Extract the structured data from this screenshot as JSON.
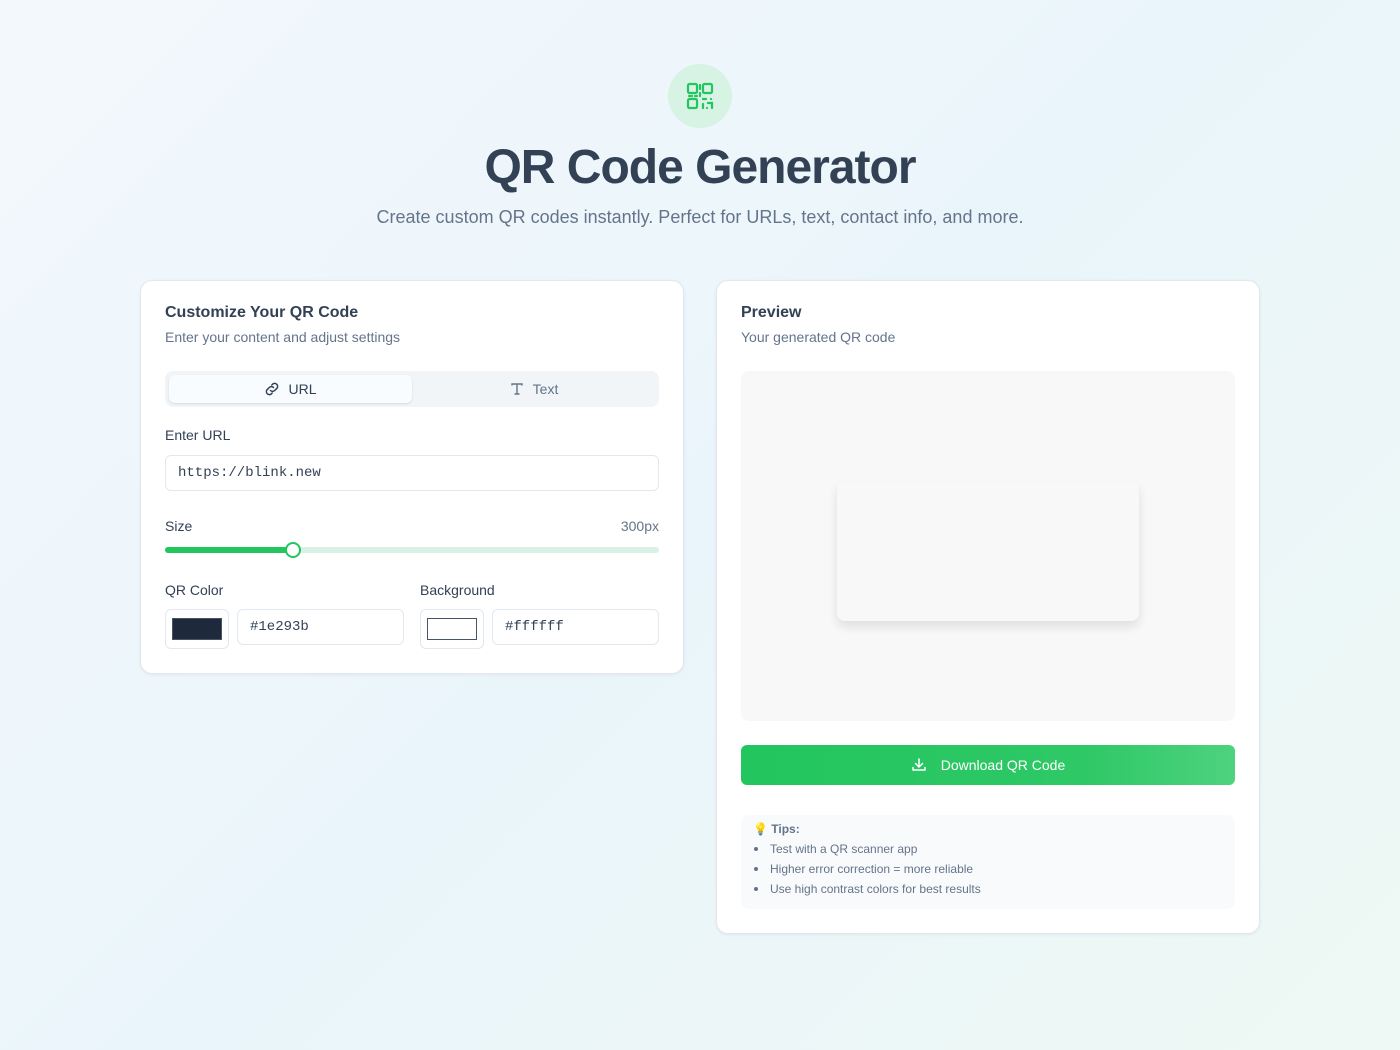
{
  "header": {
    "logo_icon": "qr-code-icon",
    "title": "QR Code Generator",
    "subtitle": "Create custom QR codes instantly. Perfect for URLs, text, contact info, and more."
  },
  "customize": {
    "title": "Customize Your QR Code",
    "description": "Enter your content and adjust settings",
    "tabs": [
      {
        "label": "URL",
        "icon": "link-icon",
        "selected": true
      },
      {
        "label": "Text",
        "icon": "text-icon",
        "selected": false
      }
    ],
    "url_label": "Enter URL",
    "url_value": "https://blink.new",
    "size_label": "Size",
    "size_value": "300px",
    "size_slider_fraction": 0.26,
    "qr_color_label": "QR Color",
    "qr_color_value": "#1e293b",
    "background_label": "Background",
    "background_value": "#ffffff"
  },
  "preview": {
    "title": "Preview",
    "description": "Your generated QR code",
    "download_label": "Download QR Code",
    "download_icon": "download-icon",
    "tips_title": "💡 Tips:",
    "tips": [
      "Test with a QR scanner app",
      "Higher error correction = more reliable",
      "Use high contrast colors for best results"
    ]
  },
  "colors": {
    "accent": "#22c55e",
    "title": "#334155",
    "muted": "#64748b"
  }
}
